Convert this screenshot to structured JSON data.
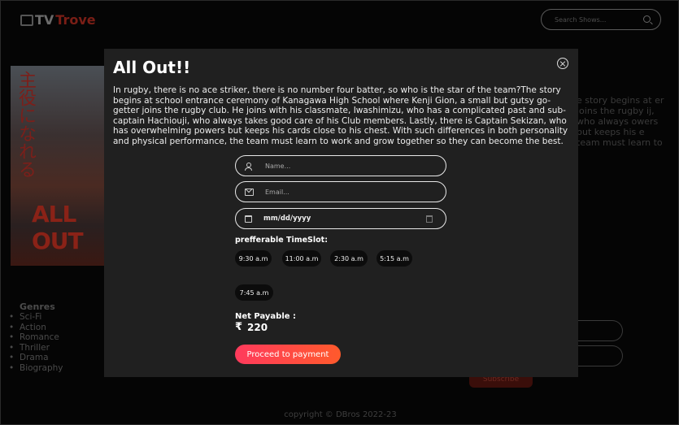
{
  "header": {
    "logo_tv": "TV",
    "logo_trove": "Trove",
    "search_placeholder": "Search Shows..."
  },
  "background": {
    "poster_jp": "主役になれる",
    "poster_title": "ALL OUT",
    "description_fragment": "e story begins at er joins the rugby ij, who always owers but keeps his e team must learn to",
    "genres_title": "Genres",
    "genres": [
      "Sci-Fi",
      "Action",
      "Romance",
      "Thriller",
      "Drama",
      "Biography"
    ],
    "subscribe_label": "Subscribe",
    "copyright": "copyright © DBros 2022-23"
  },
  "modal": {
    "title": "All Out!!",
    "description": "In rugby, there is no ace striker, there is no number four batter, so who is the star of the team?The story begins at school entrance ceremony of Kanagawa High School where Kenji Gion, a small but gutsy go-getter joins the rugby club. He joins with his classmate, Iwashimizu, who has a complicated past and sub-captain Hachiouji, who always takes good care of his Club members. Lastly, there is Captain Sekizan, who has overwhelming powers but keeps his cards close to his chest. With such differences in both personality and physical performance, the team must learn to work and grow together so they can become the best.",
    "name_placeholder": "Name...",
    "email_placeholder": "Email...",
    "date_value": "mm/dd/yyyy",
    "timeslot_label": "prefferable TimeSlot:",
    "timeslots": [
      "9:30 a.m",
      "11:00 a.m",
      "2:30 a.m",
      "5:15 a.m",
      "7:45 a.m"
    ],
    "net_payable_label": "Net Payable :",
    "currency_symbol": "₹",
    "amount": "220",
    "pay_button": "Proceed to payment"
  }
}
